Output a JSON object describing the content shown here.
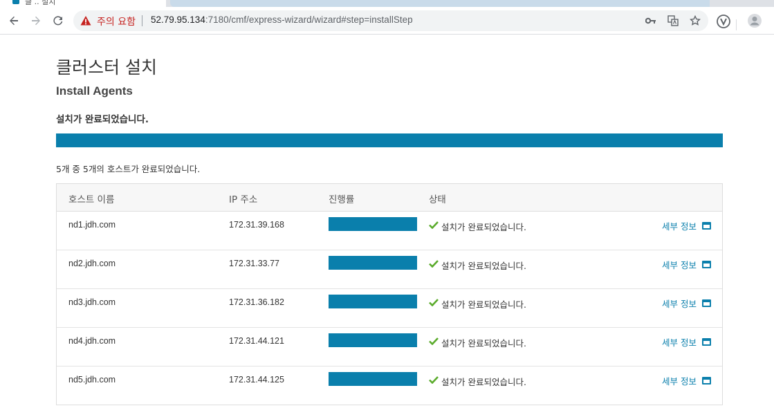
{
  "browser": {
    "tab_title_fragment": "클 .. 설치",
    "security_warning": "주의 요함",
    "url_host": "52.79.95.134",
    "url_path": ":7180/cmf/express-wizard/wizard#step=installStep"
  },
  "page": {
    "title": "클러스터 설치",
    "subtitle": "Install Agents",
    "status_message": "설치가 완료되었습니다.",
    "overall_progress": 1.0,
    "host_count_text": "5개 중 5개의 호스트가 완료되었습니다."
  },
  "table": {
    "headers": {
      "host": "호스트 이름",
      "ip": "IP 주소",
      "progress": "진행률",
      "status": "상태"
    },
    "rows": [
      {
        "host": "nd1.jdh.com",
        "ip": "172.31.39.168",
        "progress": 1.0,
        "status": "설치가 완료되었습니다.",
        "detail": "세부 정보"
      },
      {
        "host": "nd2.jdh.com",
        "ip": "172.31.33.77",
        "progress": 1.0,
        "status": "설치가 완료되었습니다.",
        "detail": "세부 정보"
      },
      {
        "host": "nd3.jdh.com",
        "ip": "172.31.36.182",
        "progress": 1.0,
        "status": "설치가 완료되었습니다.",
        "detail": "세부 정보"
      },
      {
        "host": "nd4.jdh.com",
        "ip": "172.31.44.121",
        "progress": 1.0,
        "status": "설치가 완료되었습니다.",
        "detail": "세부 정보"
      },
      {
        "host": "nd5.jdh.com",
        "ip": "172.31.44.125",
        "progress": 1.0,
        "status": "설치가 완료되었습니다.",
        "detail": "세부 정보"
      }
    ]
  },
  "icons": {
    "back": "back-arrow-icon",
    "forward": "forward-arrow-icon",
    "reload": "reload-icon",
    "warning": "warning-icon",
    "key": "key-icon",
    "translate": "translate-icon",
    "bookmark": "star-icon",
    "extension": "vivaldi-extension-icon",
    "profile": "profile-avatar-icon",
    "check": "check-icon",
    "detail": "window-icon"
  },
  "colors": {
    "accent": "#0a7fac",
    "success": "#5aab2b",
    "warning": "#c5221f"
  }
}
